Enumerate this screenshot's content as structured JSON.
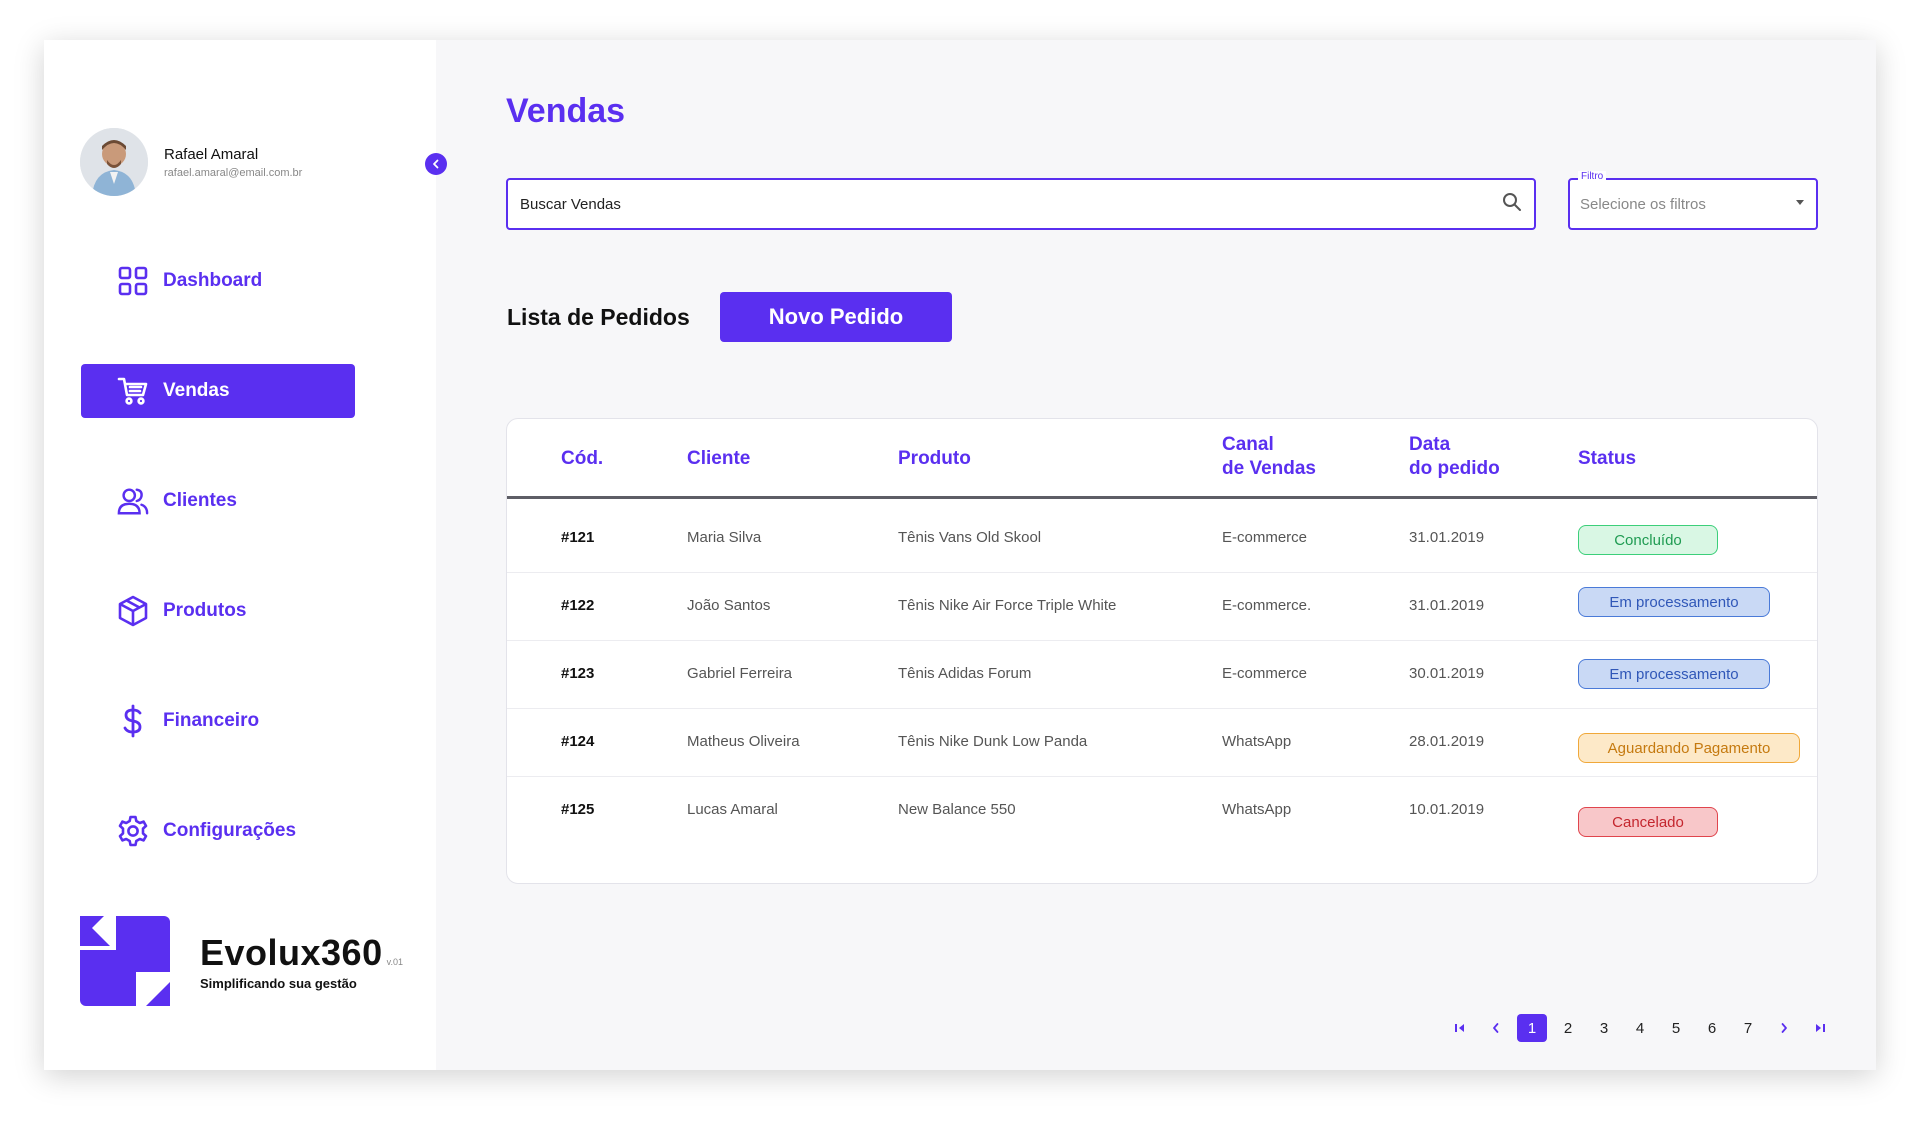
{
  "user": {
    "name": "Rafael Amaral",
    "email": "rafael.amaral@email.com.br"
  },
  "sidebar": {
    "items": [
      {
        "label": "Dashboard",
        "icon": "dashboard-grid-icon",
        "active": false
      },
      {
        "label": "Vendas",
        "icon": "shopping-cart-icon",
        "active": true
      },
      {
        "label": "Clientes",
        "icon": "users-icon",
        "active": false
      },
      {
        "label": "Produtos",
        "icon": "box-icon",
        "active": false
      },
      {
        "label": "Financeiro",
        "icon": "dollar-icon",
        "active": false
      },
      {
        "label": "Configurações",
        "icon": "gear-icon",
        "active": false
      }
    ]
  },
  "brand": {
    "name": "Evolux360",
    "version": "v.01",
    "tagline": "Simplificando sua gestão"
  },
  "page": {
    "title": "Vendas"
  },
  "search": {
    "placeholder": "Buscar Vendas"
  },
  "filter": {
    "legend": "Filtro",
    "placeholder": "Selecione os filtros"
  },
  "orders": {
    "section_title": "Lista de Pedidos",
    "new_button": "Novo Pedido",
    "columns": {
      "code": "Cód.",
      "client": "Cliente",
      "product": "Produto",
      "channel_1": "Canal",
      "channel_2": "de Vendas",
      "date_1": "Data",
      "date_2": "do pedido",
      "status": "Status"
    },
    "rows": [
      {
        "code": "#121",
        "client": "Maria Silva",
        "product": "Tênis Vans Old Skool",
        "channel": "E-commerce",
        "date": "31.01.2019",
        "status": "Concluído"
      },
      {
        "code": "#122",
        "client": "João Santos",
        "product": "Tênis Nike Air Force Triple White",
        "channel": "E-commerce.",
        "date": "31.01.2019",
        "status": "Em processamento"
      },
      {
        "code": "#123",
        "client": "Gabriel Ferreira",
        "product": "Tênis Adidas Forum",
        "channel": "E-commerce",
        "date": "30.01.2019",
        "status": "Em processamento"
      },
      {
        "code": "#124",
        "client": "Matheus Oliveira",
        "product": "Tênis Nike Dunk Low Panda",
        "channel": "WhatsApp",
        "date": "28.01.2019",
        "status": "Aguardando Pagamento"
      },
      {
        "code": "#125",
        "client": "Lucas Amaral",
        "product": "New Balance 550",
        "channel": "WhatsApp",
        "date": "10.01.2019",
        "status": "Cancelado"
      }
    ]
  },
  "status_colors": {
    "Concluído": {
      "bg": "#d9f7e4",
      "border": "#3ccf7a",
      "text": "#1f9b52"
    },
    "Em processamento": {
      "bg": "#c9d9f5",
      "border": "#4a7ad8",
      "text": "#3057b8"
    },
    "Aguardando Pagamento": {
      "bg": "#fde9c8",
      "border": "#f0a83a",
      "text": "#c57a10"
    },
    "Cancelado": {
      "bg": "#f8c7c9",
      "border": "#e0454d",
      "text": "#c4262e"
    }
  },
  "pagination": {
    "pages": [
      "1",
      "2",
      "3",
      "4",
      "5",
      "6",
      "7"
    ],
    "current": "1"
  },
  "colors": {
    "accent": "#5a2ff0"
  }
}
